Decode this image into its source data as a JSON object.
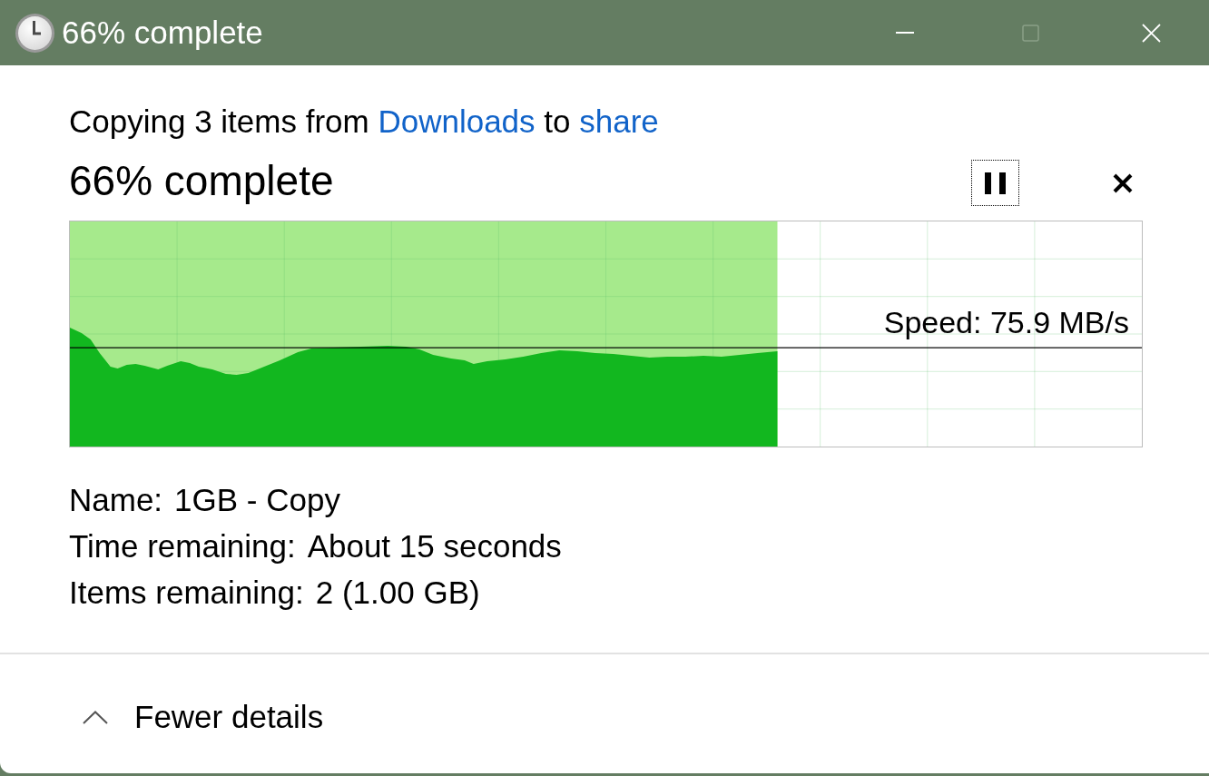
{
  "window": {
    "title": "66% complete",
    "maximize_disabled": true
  },
  "summary": [
    {
      "kind": "text",
      "text": "Copying 3 items from "
    },
    {
      "kind": "link",
      "text": "Downloads"
    },
    {
      "kind": "text",
      "text": " to "
    },
    {
      "kind": "link",
      "text": "share"
    }
  ],
  "heading": "66% complete",
  "controls": [
    {
      "kind": "pause",
      "focused": true
    },
    {
      "kind": "cancel",
      "focused": false
    }
  ],
  "progress": {
    "level": 0.66,
    "speed": "Speed: 75.9 MB/s"
  },
  "details": [
    {
      "label": "Name:",
      "value": "1GB - Copy"
    },
    {
      "label": "Time remaining:",
      "value": "About 15 seconds"
    },
    {
      "label": "Items remaining:",
      "value": "2 (1.00 GB)"
    }
  ],
  "footer": {
    "label": "Fewer details",
    "expanded": true
  }
}
